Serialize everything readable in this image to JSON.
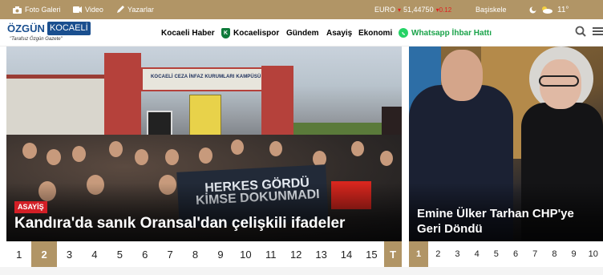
{
  "topbar": {
    "photo_gallery": "Foto Galeri",
    "video": "Video",
    "authors": "Yazarlar",
    "currency_name": "EURO",
    "currency_value": "51,44750",
    "currency_change": "0.12",
    "city": "Başiskele",
    "temperature": "11°"
  },
  "header": {
    "logo_main": "ÖZGÜN",
    "logo_sub": "KOCAELİ",
    "slogan": "\"Tarafsız Özgün Gazete\"",
    "nav": [
      "Kocaeli Haber",
      "Kocaelispor",
      "Gündem",
      "Asayiş",
      "Ekonomi"
    ],
    "whatsapp": "Whatsapp İhbar Hattı",
    "kocaelispor_badge": "K"
  },
  "main_slider": {
    "gate_text": "KOCAELİ CEZA İNFAZ KURUMLARI KAMPÜSÜ",
    "banner_text": "HERKES GÖRDÜ KİMSE DOKUNMADI",
    "category": "ASAYİŞ",
    "headline": "Kandıra'da sanık Oransal'dan çelişkili ifadeler",
    "pages": [
      "1",
      "2",
      "3",
      "4",
      "5",
      "6",
      "7",
      "8",
      "9",
      "10",
      "11",
      "12",
      "13",
      "14",
      "15"
    ],
    "active_page": "2",
    "last_label": "T"
  },
  "side_slider": {
    "headline": "Emine Ülker Tarhan CHP'ye Geri Döndü",
    "pages": [
      "1",
      "2",
      "3",
      "4",
      "5",
      "6",
      "7",
      "8",
      "9",
      "10"
    ],
    "active_page": "1"
  },
  "colors": {
    "accent": "#b19566",
    "category_red": "#d31f26",
    "whatsapp_green": "#1aa34a"
  },
  "icons": [
    "camera-icon",
    "video-icon",
    "pen-icon",
    "weather-icon",
    "search-icon",
    "menu-icon",
    "whatsapp-icon"
  ]
}
